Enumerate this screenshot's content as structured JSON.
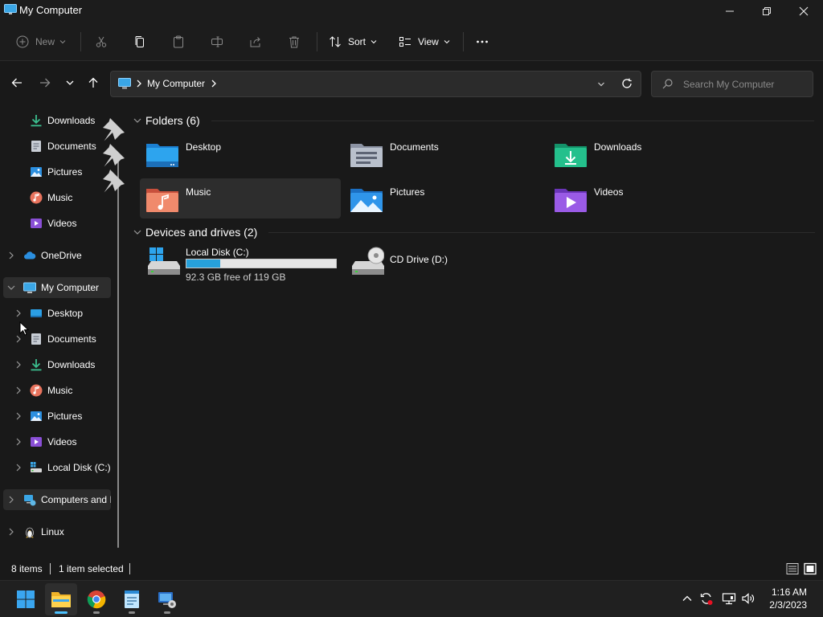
{
  "window": {
    "title": "My Computer",
    "icon": "computer-icon",
    "controls": [
      "minimize-icon",
      "maximize-icon",
      "close-icon"
    ]
  },
  "commandbar": {
    "new_label": "New",
    "sort_label": "Sort",
    "view_label": "View",
    "more_icon": "more-icon",
    "disabled_icons": [
      "cut-icon",
      "copy-icon",
      "paste-icon",
      "rename-icon",
      "share-icon",
      "delete-icon"
    ]
  },
  "address": {
    "crumb": "My Computer",
    "search_placeholder": "Search My Computer"
  },
  "sidebar": {
    "quick_access": [
      {
        "label": "Downloads",
        "icon": "downloads-icon",
        "pinned": true
      },
      {
        "label": "Documents",
        "icon": "documents-icon",
        "pinned": true
      },
      {
        "label": "Pictures",
        "icon": "pictures-icon",
        "pinned": true
      },
      {
        "label": "Music",
        "icon": "music-icon",
        "pinned": false
      },
      {
        "label": "Videos",
        "icon": "videos-icon",
        "pinned": false
      }
    ],
    "onedrive": "OneDrive",
    "this_pc": "My Computer",
    "pc_children": [
      "Desktop",
      "Documents",
      "Downloads",
      "Music",
      "Pictures",
      "Videos",
      "Local Disk (C:)"
    ],
    "network": "Computers and I",
    "linux": "Linux"
  },
  "main": {
    "folders_header": "Folders (6)",
    "folders": [
      "Desktop",
      "Documents",
      "Downloads",
      "Music",
      "Pictures",
      "Videos"
    ],
    "drives_header": "Devices and drives (2)",
    "drives": [
      {
        "name": "Local Disk (C:)",
        "free": "92.3 GB free of 119 GB",
        "used_fraction": 0.224
      },
      {
        "name": "CD Drive (D:)"
      }
    ]
  },
  "status": {
    "items": "8 items",
    "selected": "1 item selected"
  },
  "taskbar": {
    "time": "1:16 AM",
    "date": "2/3/2023"
  },
  "colors": {
    "accent": "#4cc2ff",
    "background": "#191919",
    "progress": "#26a0da"
  }
}
